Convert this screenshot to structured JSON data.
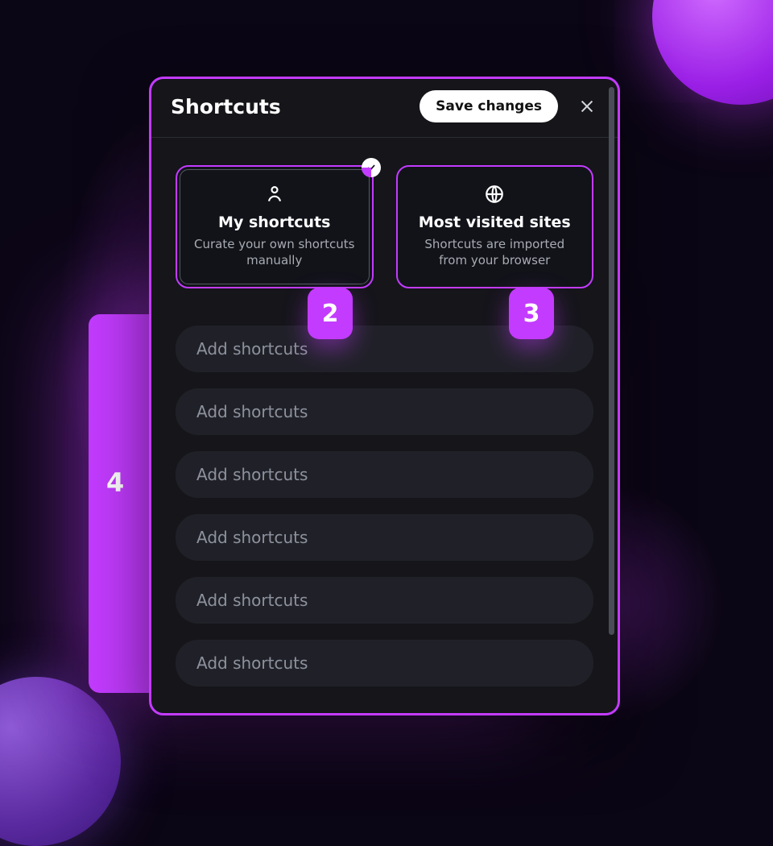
{
  "decor": {
    "step2_label": "2",
    "step3_label": "3",
    "backcard_label": "4"
  },
  "dialog": {
    "title": "Shortcuts",
    "save_label": "Save changes",
    "options": {
      "my_shortcuts": {
        "title": "My shortcuts",
        "desc": "Curate your own shortcuts manually",
        "selected": true
      },
      "most_visited": {
        "title": "Most visited sites",
        "desc": "Shortcuts are imported from your browser",
        "selected": false
      }
    },
    "slots": [
      "Add shortcuts",
      "Add shortcuts",
      "Add shortcuts",
      "Add shortcuts",
      "Add shortcuts",
      "Add shortcuts"
    ]
  }
}
